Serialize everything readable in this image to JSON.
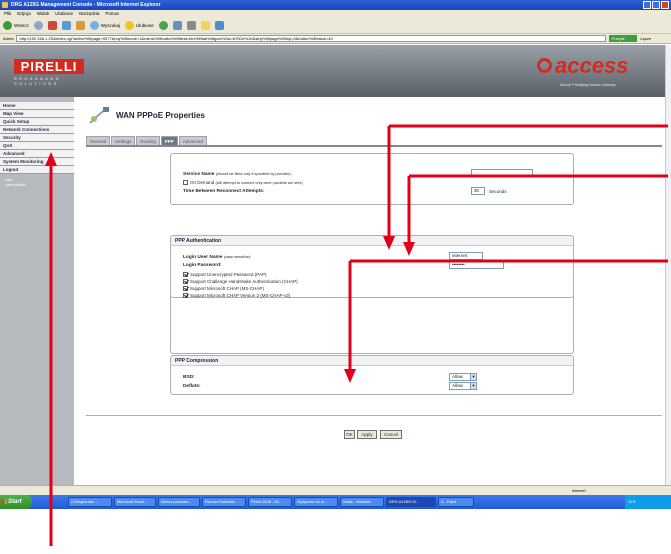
{
  "window": {
    "title": "DRG A125G Management Console - Microsoft Internet Explorer"
  },
  "menubar": {
    "items": [
      "Plik",
      "Edycja",
      "Widok",
      "Ulubione",
      "Narzędzia",
      "Pomoc"
    ]
  },
  "toolbar": {
    "back": "Wstecz",
    "search": "Wyszukaj",
    "favorites": "Ulubione"
  },
  "address": {
    "label": "Adres",
    "url": "http://192.168.1.254/index.cgi?active%5fpage=9077&req%5fmode=1&mimic%5fbutton%5ffield=btn%5ftab%5fgoto%3a=40%2e%2e&strip%5fpage%5ftop=0&button%5fvalue=40",
    "go": "Przejdź",
    "links": "Łącze"
  },
  "banner": {
    "brand": "IRELLI",
    "brand_p": "P",
    "broadband": "BROADBAND SOLUTIONS",
    "product": "access",
    "product_sub": "Discus™ Multiplay Access Gateway"
  },
  "sidebar": {
    "items": [
      {
        "label": "Home"
      },
      {
        "label": "Map View"
      },
      {
        "label": "Quick Setup"
      },
      {
        "label": "Network Connections"
      },
      {
        "label": "Security"
      },
      {
        "label": "QoS"
      },
      {
        "label": "Advanced"
      },
      {
        "label": "System Monitoring"
      },
      {
        "label": "Logout"
      }
    ],
    "user_label": "User:",
    "user_name": "Administrator"
  },
  "main": {
    "title": "WAN PPPoE Properties",
    "tabs": [
      "General",
      "Settings",
      "Routing",
      "PPP",
      "Advanced"
    ],
    "active_tab": "PPP"
  },
  "ppp": {
    "service_name_label": "Service Name",
    "service_name_note": "(should be filled only if specified by provider):",
    "service_name_value": "",
    "on_demand_label": "On Demand",
    "on_demand_note": "(will attempt to connect only when packets are sent)",
    "reconnect_label": "Time Between Reconnect Attempts:",
    "reconnect_value": "30",
    "reconnect_unit": "Seconds"
  },
  "auth": {
    "head": "PPP Authentication",
    "login_label": "Login User Name",
    "login_note": "(case sensitive):",
    "login_value": "internet",
    "password_label": "Login Password:",
    "password_value": "••••••••",
    "options": [
      {
        "label": "Support Unencrypted Password (PAP)",
        "checked": true
      },
      {
        "label": "Support Challenge Handshake Authentication (CHAP)",
        "checked": true
      },
      {
        "label": "Support Microsoft CHAP (MS-CHAP)",
        "checked": true
      },
      {
        "label": "Support Microsoft CHAP Version 2 (MS-CHAP-v2)",
        "checked": true
      }
    ]
  },
  "compression": {
    "head": "PPP Compression",
    "bsd_label": "BSD:",
    "bsd_value": "Allow",
    "deflate_label": "Deflate:",
    "deflate_value": "Allow"
  },
  "buttons": {
    "ok": "OK",
    "apply": "Apply",
    "cancel": "Cancel"
  },
  "statusbar": {
    "zone": "Internet"
  },
  "taskbar": {
    "start": "Start",
    "tasks": [
      "2 Eksplorator ...",
      "Microsoft Excel...",
      "Wersz polecani...",
      "Roman Rudnicki...",
      "Pirelli 2008 - Mi...",
      "Wytyczne do in...",
      "hasła - Notatnik",
      "DRG A125G M...",
      "4 - Paint"
    ],
    "clock": "11:5"
  },
  "colors": {
    "annotation_arrow": "#e0001a",
    "brand_red": "#d42a1f",
    "active_tab": "#6e7780"
  }
}
